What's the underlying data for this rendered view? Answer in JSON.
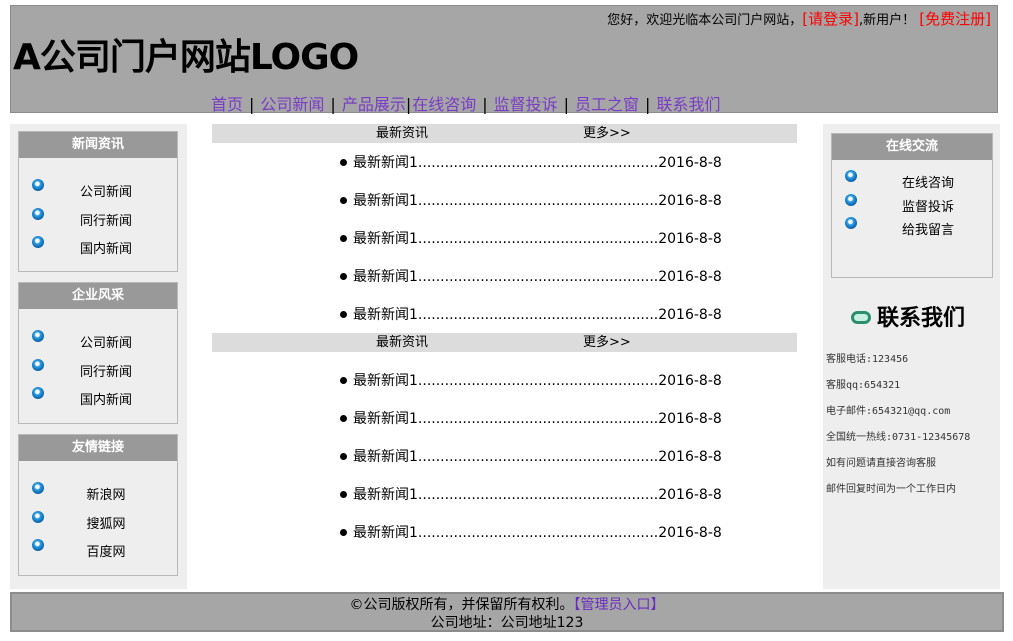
{
  "header": {
    "welcome_pre": "您好，欢迎光临本公司门户网站，",
    "login": "[请登录]",
    "welcome_mid": ",新用户！",
    "register": "[免费注册]",
    "logo": "A公司门户网站LOGO",
    "nav": [
      "首页",
      "公司新闻",
      "产品展示",
      "在线咨询",
      "监督投诉",
      "员工之窗",
      "联系我们"
    ]
  },
  "left": {
    "boxes": [
      {
        "title": "新闻资讯",
        "items": [
          "公司新闻",
          "同行新闻",
          "国内新闻"
        ]
      },
      {
        "title": "企业风采",
        "items": [
          "公司新闻",
          "同行新闻",
          "国内新闻"
        ]
      },
      {
        "title": "友情链接",
        "items": [
          "新浪网",
          "搜狐网",
          "百度网"
        ]
      }
    ]
  },
  "center": {
    "sections": [
      {
        "title": "最新资讯",
        "more": "更多>>",
        "items": [
          {
            "title": "最新新闻1",
            "dots": "......................................................",
            "date": "2016-8-8"
          },
          {
            "title": "最新新闻1",
            "dots": "......................................................",
            "date": "2016-8-8"
          },
          {
            "title": "最新新闻1",
            "dots": "......................................................",
            "date": "2016-8-8"
          },
          {
            "title": "最新新闻1",
            "dots": "......................................................",
            "date": "2016-8-8"
          },
          {
            "title": "最新新闻1",
            "dots": "......................................................",
            "date": "2016-8-8"
          }
        ]
      },
      {
        "title": "最新资讯",
        "more": "更多>>",
        "items": [
          {
            "title": "最新新闻1",
            "dots": "......................................................",
            "date": "2016-8-8"
          },
          {
            "title": "最新新闻1",
            "dots": "......................................................",
            "date": "2016-8-8"
          },
          {
            "title": "最新新闻1",
            "dots": "......................................................",
            "date": "2016-8-8"
          },
          {
            "title": "最新新闻1",
            "dots": "......................................................",
            "date": "2016-8-8"
          },
          {
            "title": "最新新闻1",
            "dots": "......................................................",
            "date": "2016-8-8"
          }
        ]
      }
    ]
  },
  "right": {
    "box_title": "在线交流",
    "box_items": [
      "在线咨询",
      "监督投诉",
      "给我留言"
    ],
    "contact_title": "联系我们",
    "contact_lines": [
      "客服电话:123456",
      "客服qq:654321",
      "电子邮件:654321@qq.com",
      "全国统一热线:0731-12345678",
      "如有问题请直接咨询客服",
      "邮件回复时间为一个工作日内"
    ]
  },
  "footer": {
    "copyright": "©公司版权所有，并保留所有权利。",
    "admin": "【管理员入口】",
    "address": "公司地址：公司地址123"
  }
}
